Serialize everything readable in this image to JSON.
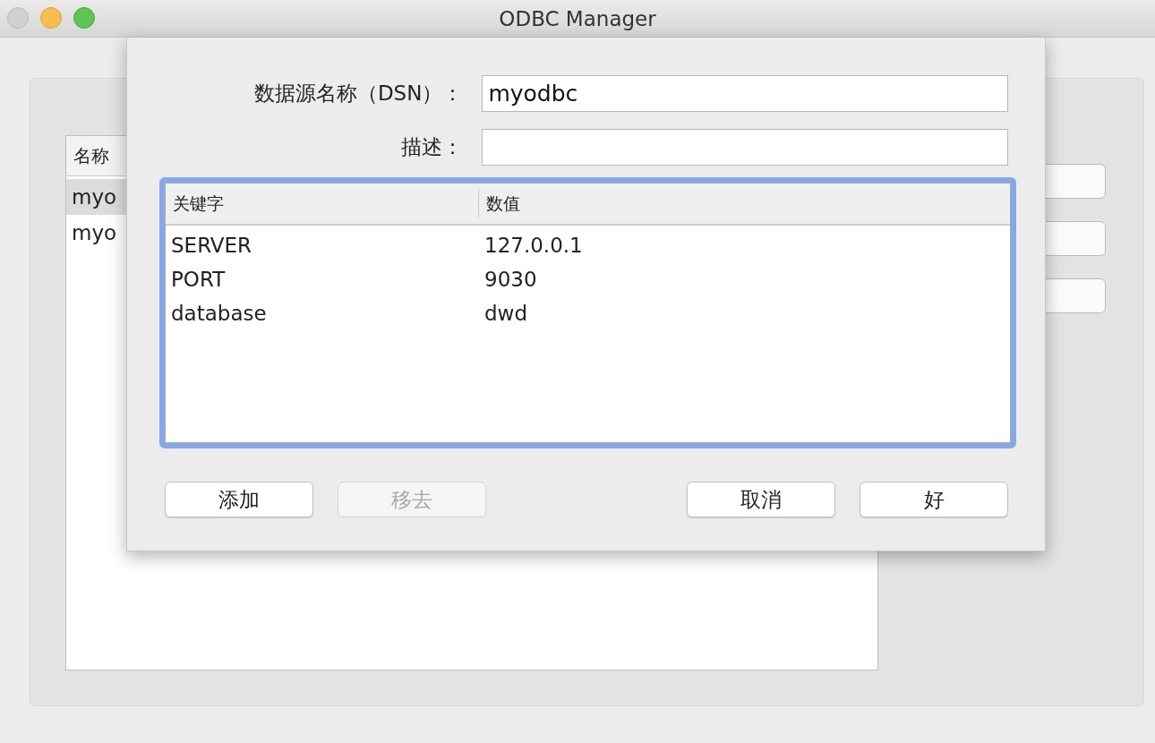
{
  "window": {
    "title": "ODBC Manager"
  },
  "background_list": {
    "columns": [
      "名称"
    ],
    "rows": [
      {
        "name": "myo",
        "selected": true
      },
      {
        "name": "myo",
        "selected": false
      }
    ]
  },
  "dialog": {
    "fields": [
      {
        "label": "数据源名称（DSN）：",
        "value": "myodbc"
      },
      {
        "label": "描述："
      }
    ],
    "table": {
      "focused": true,
      "columns": [
        "关键字",
        "数值"
      ],
      "rows": [
        [
          "SERVER",
          "127.0.0.1"
        ],
        [
          "PORT",
          "9030"
        ],
        [
          "database",
          "dwd"
        ]
      ]
    },
    "left_buttons": [
      {
        "label": "添加",
        "disabled": false
      },
      {
        "label": "移去",
        "disabled": true
      }
    ],
    "right_buttons": [
      {
        "label": "取消",
        "disabled": false
      },
      {
        "label": "好",
        "disabled": false
      }
    ]
  }
}
